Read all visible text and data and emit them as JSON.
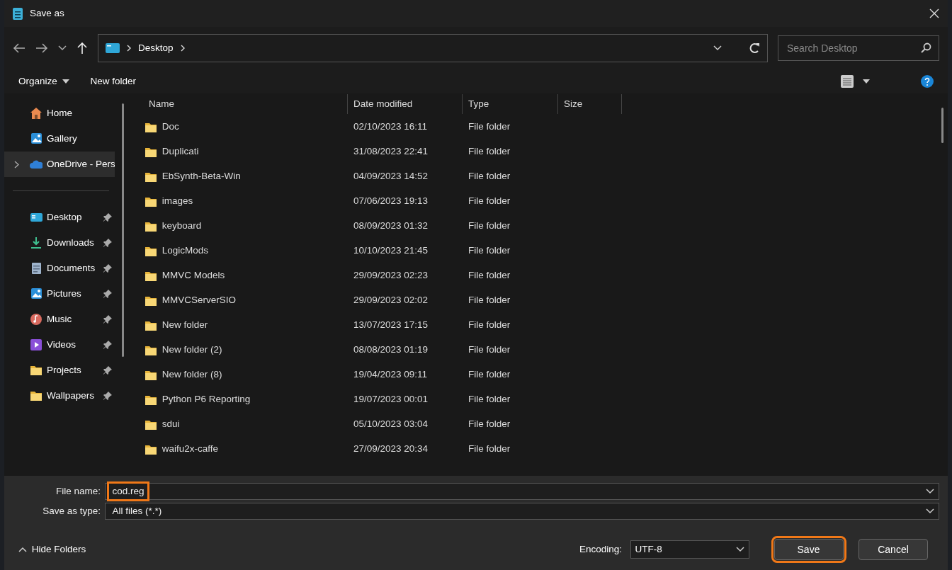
{
  "window": {
    "title": "Save as"
  },
  "nav": {
    "breadcrumb": [
      "Desktop"
    ],
    "search": {
      "placeholder": "Search Desktop"
    }
  },
  "toolbar": {
    "organize": "Organize",
    "new_folder": "New folder"
  },
  "sidebar": {
    "groups": [
      [
        {
          "label": "Home",
          "kind": "home",
          "pinned": false,
          "expandable": false,
          "selected": false
        },
        {
          "label": "Gallery",
          "kind": "gallery",
          "pinned": false,
          "expandable": false,
          "selected": false
        },
        {
          "label": "OneDrive - Pers",
          "kind": "cloud",
          "pinned": false,
          "expandable": true,
          "selected": true
        }
      ],
      [
        {
          "label": "Desktop",
          "kind": "desktop",
          "pinned": true,
          "expandable": false,
          "selected": false
        },
        {
          "label": "Downloads",
          "kind": "download",
          "pinned": true,
          "expandable": false,
          "selected": false
        },
        {
          "label": "Documents",
          "kind": "document",
          "pinned": true,
          "expandable": false,
          "selected": false
        },
        {
          "label": "Pictures",
          "kind": "pictures",
          "pinned": true,
          "expandable": false,
          "selected": false
        },
        {
          "label": "Music",
          "kind": "music",
          "pinned": true,
          "expandable": false,
          "selected": false
        },
        {
          "label": "Videos",
          "kind": "videos",
          "pinned": true,
          "expandable": false,
          "selected": false
        },
        {
          "label": "Projects",
          "kind": "folder",
          "pinned": true,
          "expandable": false,
          "selected": false
        },
        {
          "label": "Wallpapers",
          "kind": "folder",
          "pinned": true,
          "expandable": false,
          "selected": false
        }
      ]
    ]
  },
  "table": {
    "columns": [
      "Name",
      "Date modified",
      "Type",
      "Size"
    ],
    "rows": [
      {
        "name": "Doc",
        "date": "02/10/2023 16:11",
        "type": "File folder"
      },
      {
        "name": "Duplicati",
        "date": "31/08/2023 22:41",
        "type": "File folder"
      },
      {
        "name": "EbSynth-Beta-Win",
        "date": "04/09/2023 14:52",
        "type": "File folder"
      },
      {
        "name": "images",
        "date": "07/06/2023 19:13",
        "type": "File folder"
      },
      {
        "name": "keyboard",
        "date": "08/09/2023 01:32",
        "type": "File folder"
      },
      {
        "name": "LogicMods",
        "date": "10/10/2023 21:45",
        "type": "File folder"
      },
      {
        "name": "MMVC Models",
        "date": "29/09/2023 02:23",
        "type": "File folder"
      },
      {
        "name": "MMVCServerSIO",
        "date": "29/09/2023 02:02",
        "type": "File folder"
      },
      {
        "name": "New folder",
        "date": "13/07/2023 17:15",
        "type": "File folder"
      },
      {
        "name": "New folder (2)",
        "date": "08/08/2023 01:19",
        "type": "File folder"
      },
      {
        "name": "New folder (8)",
        "date": "19/04/2023 09:11",
        "type": "File folder"
      },
      {
        "name": "Python P6 Reporting",
        "date": "19/07/2023 00:01",
        "type": "File folder"
      },
      {
        "name": "sdui",
        "date": "05/10/2023 03:04",
        "type": "File folder"
      },
      {
        "name": "waifu2x-caffe",
        "date": "27/09/2023 20:34",
        "type": "File folder"
      }
    ]
  },
  "footer": {
    "file_name": {
      "label": "File name:",
      "value": "cod.reg",
      "highlighted": true
    },
    "save_type": {
      "label": "Save as type:",
      "value": "All files  (*.*)"
    },
    "hide_folders": "Hide Folders",
    "encoding": {
      "label": "Encoding:",
      "value": "UTF-8"
    },
    "buttons": [
      {
        "label": "Save",
        "highlighted": true
      },
      {
        "label": "Cancel",
        "highlighted": false
      }
    ]
  }
}
